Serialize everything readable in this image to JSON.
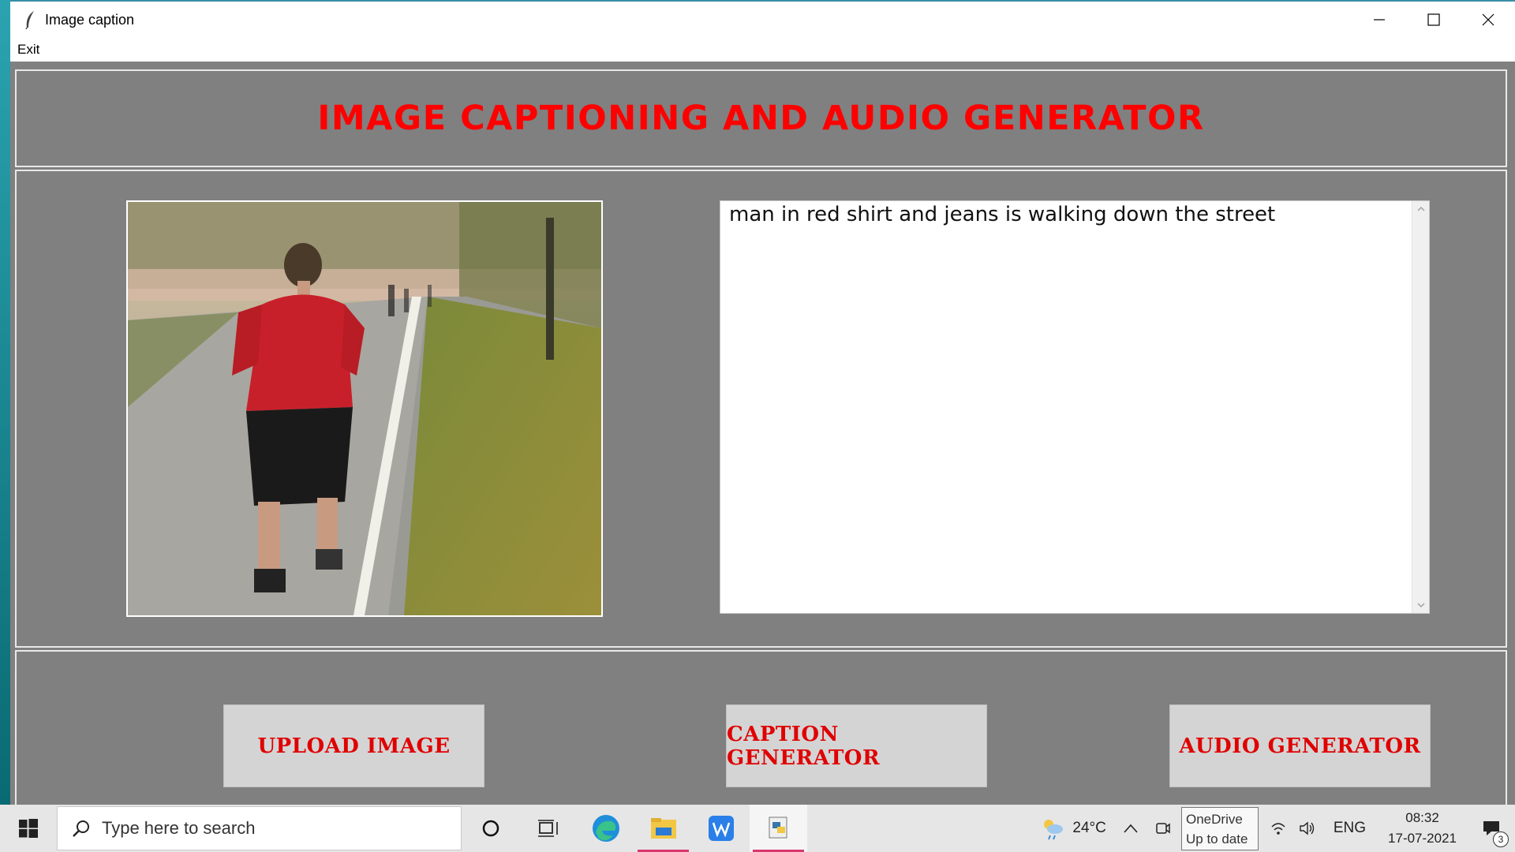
{
  "window": {
    "title": "Image caption",
    "icon": "feather-icon",
    "controls": [
      "minimize-icon",
      "maximize-icon",
      "close-icon"
    ]
  },
  "menu": {
    "items": [
      "Exit"
    ]
  },
  "header": {
    "title": "IMAGE CAPTIONING AND AUDIO GENERATOR"
  },
  "main": {
    "image_alt": "photo of man in red shirt running on a road",
    "caption": "man in red shirt and jeans is walking down the street"
  },
  "buttons": {
    "upload": "UPLOAD IMAGE",
    "caption": "CAPTION GENERATOR",
    "audio": "AUDIO GENERATOR"
  },
  "taskbar": {
    "search_placeholder": "Type here to search",
    "weather": "24°C",
    "onedrive_line1": "OneDrive",
    "onedrive_line2": "Up to date",
    "language": "ENG",
    "time": "08:32",
    "date": "17-07-2021",
    "notifications": "3"
  },
  "colors": {
    "accent_red": "#ff0000",
    "background_gray": "#808080",
    "button_gray": "#d4d4d4"
  }
}
